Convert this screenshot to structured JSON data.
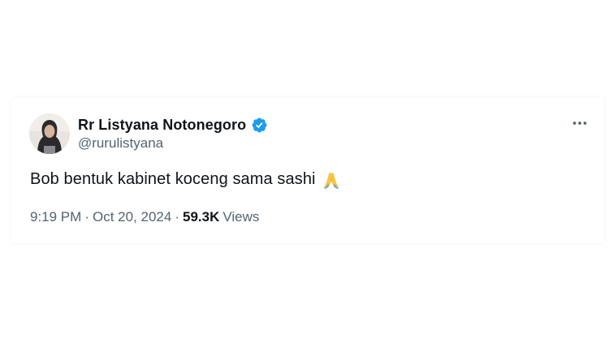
{
  "tweet": {
    "author": {
      "display_name": "Rr Listyana Notonegoro",
      "handle": "@rurulistyana",
      "verified": true
    },
    "text": "Bob bentuk kabinet koceng sama sashi",
    "emoji": "🙏",
    "meta": {
      "time": "9:19 PM",
      "separator": "·",
      "date": "Oct 20, 2024",
      "views_count": "59.3K",
      "views_label": "Views"
    }
  },
  "colors": {
    "text_primary": "#0f1419",
    "text_secondary": "#536471",
    "verified_blue": "#1d9bf0"
  },
  "icons": {
    "more": "more-horizontal-icon",
    "verified": "verified-badge-icon",
    "emoji": "folded-hands-emoji"
  }
}
